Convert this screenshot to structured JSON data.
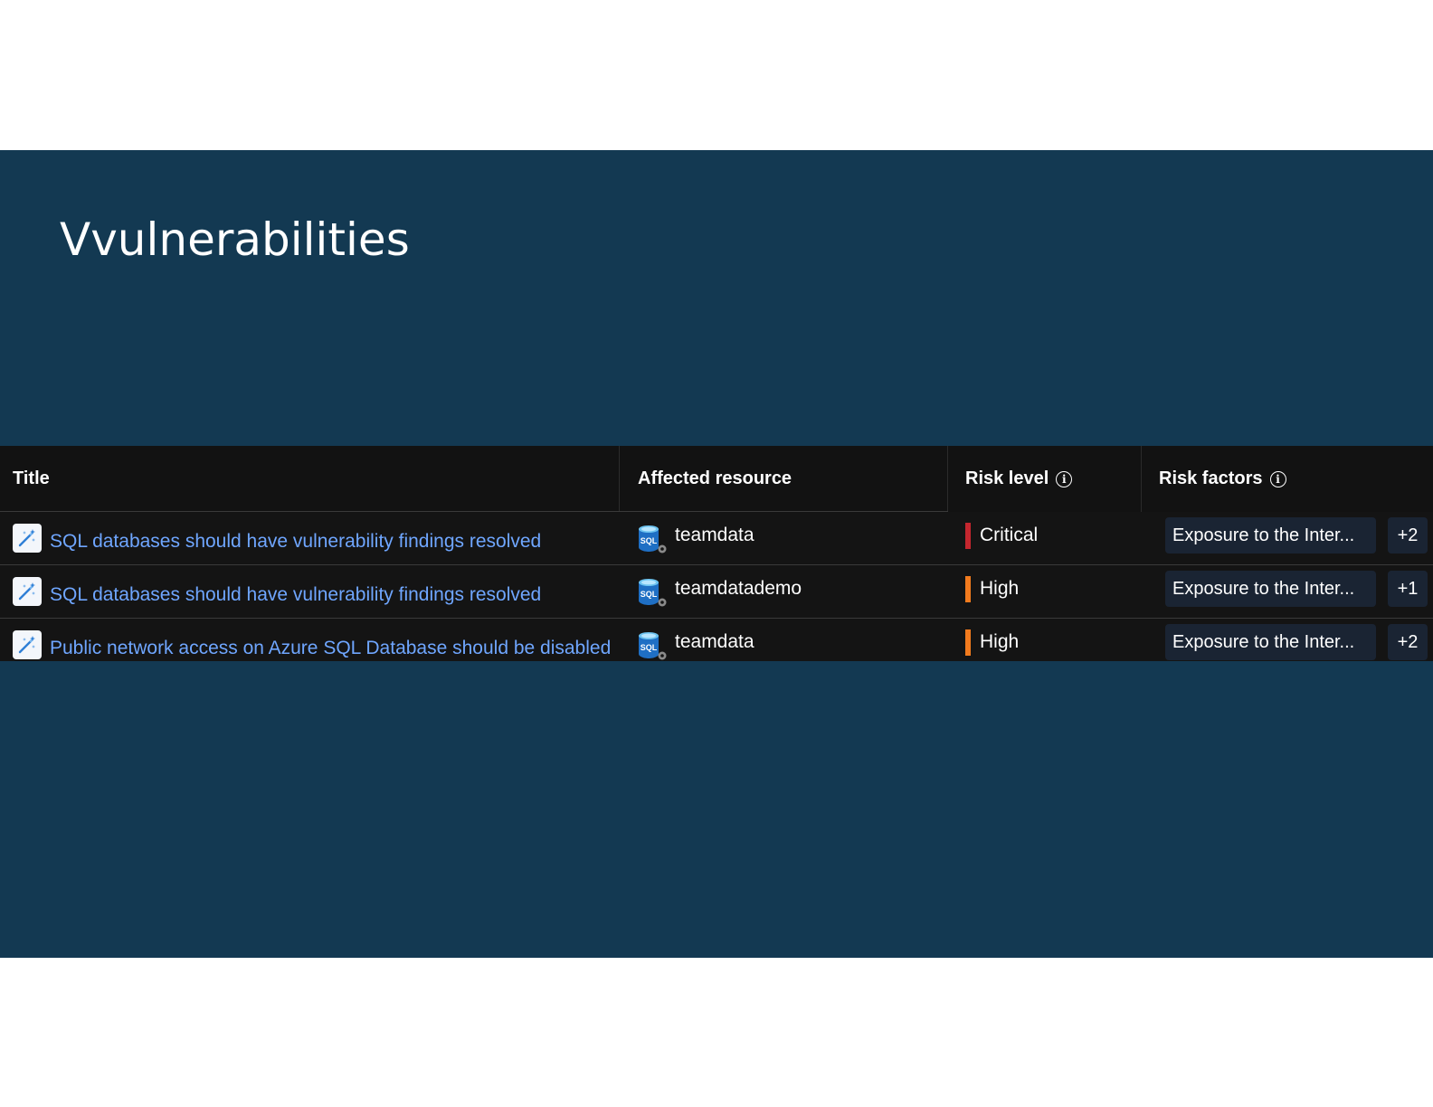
{
  "slide": {
    "title": "Vvulnerabilities"
  },
  "table": {
    "columns": {
      "title": "Title",
      "affected_resource": "Affected resource",
      "risk_level": "Risk level",
      "risk_factors": "Risk factors"
    },
    "rows": [
      {
        "title": "SQL databases should have vulnerability findings resolved",
        "resource": "teamdata",
        "risk_level": "Critical",
        "risk_color": "#c4262e",
        "risk_factor": "Exposure to the Inter...",
        "more": "+2"
      },
      {
        "title": "SQL databases should have vulnerability findings resolved",
        "resource": "teamdatademo",
        "risk_level": "High",
        "risk_color": "#f27b1e",
        "risk_factor": "Exposure to the Inter...",
        "more": "+1"
      },
      {
        "title": "Public network access on Azure SQL Database should be disabled",
        "resource": "teamdata",
        "risk_level": "High",
        "risk_color": "#f27b1e",
        "risk_factor": "Exposure to the Inter...",
        "more": "+2"
      }
    ]
  },
  "colors": {
    "slide_background": "#133952",
    "grid_background": "#141414",
    "link": "#6fa6ff",
    "chip_background": "#1a2433"
  },
  "icons": {
    "recommendation": "magic-wand-icon",
    "resource": "sql-database-icon",
    "info": "info-icon"
  }
}
